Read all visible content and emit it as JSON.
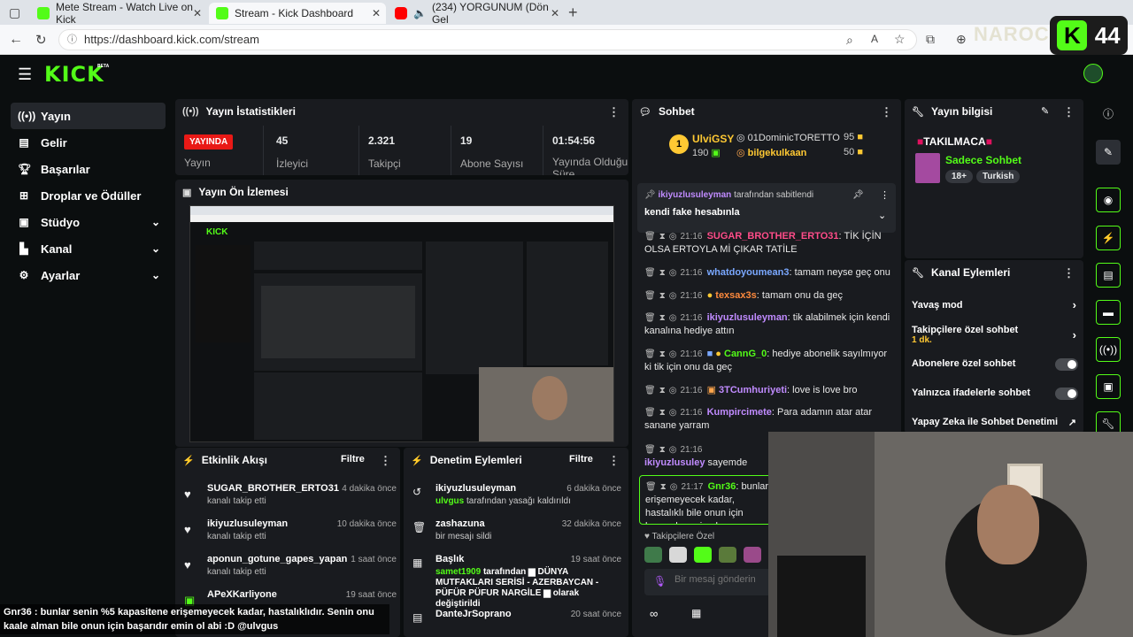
{
  "browser": {
    "tabs": [
      {
        "title": "Mete Stream - Watch Live on Kick"
      },
      {
        "title": "Stream - Kick Dashboard"
      },
      {
        "title": "(234) YORGUNUM (Dön Gel"
      }
    ],
    "url": "https://dashboard.kick.com/stream",
    "overlay_logo_text": "44",
    "overlay_watermark": "NAROC"
  },
  "brand": {
    "logo": "KICK",
    "logo_sup": "BETA",
    "accent": "#53fc18"
  },
  "sidebar": {
    "items": [
      {
        "label": "Yayın"
      },
      {
        "label": "Gelir"
      },
      {
        "label": "Başarılar"
      },
      {
        "label": "Droplar ve Ödüller"
      },
      {
        "label": "Stüdyo"
      },
      {
        "label": "Kanal"
      },
      {
        "label": "Ayarlar"
      }
    ]
  },
  "stats": {
    "title": "Yayın İstatistikleri",
    "live_badge": "YAYINDA",
    "live_label": "Yayın",
    "items": [
      {
        "value": "45",
        "label": "İzleyici"
      },
      {
        "value": "2.321",
        "label": "Takipçi"
      },
      {
        "value": "19",
        "label": "Abone Sayısı"
      },
      {
        "value": "01:54:56",
        "label": "Yayında Olduğu Süre"
      }
    ]
  },
  "preview": {
    "title": "Yayın Ön İzlemesi"
  },
  "activity": {
    "title": "Etkinlik Akışı",
    "filter": "Filtre",
    "items": [
      {
        "name": "SUGAR_BROTHER_ERTO31",
        "sub": "kanalı takip etti",
        "time": "4 dakika önce"
      },
      {
        "name": "ikiyuzlusuleyman",
        "sub": "kanalı takip etti",
        "time": "10 dakika önce"
      },
      {
        "name": "aponun_gotune_gapes_yapan",
        "sub": "kanalı takip etti",
        "time": "1 saat önce"
      },
      {
        "name": "APeXKarliyone",
        "sub": "",
        "time": "19 saat önce"
      }
    ]
  },
  "moderation": {
    "title": "Denetim Eylemleri",
    "filter": "Filtre",
    "items": [
      {
        "name": "ikiyuzlusuleyman",
        "actor": "ulvgus",
        "sub": "tarafından yasağı kaldırıldı",
        "time": "6 dakika önce"
      },
      {
        "name": "zashazuna",
        "actor": "",
        "sub": "bir mesajı sildi",
        "time": "32 dakika önce"
      },
      {
        "name": "Başlık",
        "actor": "samet1909",
        "sub": "tarafından ▆ DÜNYA MUTFAKLARI SERİSİ - AZERBAYCAN - PÜFÜR PÜFUR NARGİLE ▆ olarak değiştirildi",
        "time": "19 saat önce"
      },
      {
        "name": "DanteJrSoprano",
        "actor": "",
        "sub": "",
        "time": "20 saat önce"
      }
    ]
  },
  "chat": {
    "title": "Sohbet",
    "top": [
      {
        "name": "UlviGSY",
        "count": "190",
        "rank": "1"
      },
      {
        "name": "01DominicTORETTO",
        "count": "95"
      },
      {
        "name": "bilgekulkaan",
        "count": "50"
      }
    ],
    "pinned_by_user": "ikiyuzlusuleyman",
    "pinned_by_suffix": "tarafından sabitlendi",
    "pinned_text": "kendi fake hesabınla",
    "messages": [
      {
        "time": "21:16",
        "user": "SUGAR_BROTHER_ERTO31",
        "text": "TİK İÇİN OLSA ERTOYLA Mİ ÇIKAR TATİLE"
      },
      {
        "time": "21:16",
        "user": "whatdoyoumean3",
        "text": "tamam neyse geç onu"
      },
      {
        "time": "21:16",
        "user": "texsax3s",
        "text": "tamam onu da geç"
      },
      {
        "time": "21:16",
        "user": "ikiyuzlusuleyman",
        "text": "tik alabilmek için kendi kanalına hediye attın"
      },
      {
        "time": "21:16",
        "user": "CannG_0",
        "text": "hediye abonelik sayılmıyor ki tik için onu da geç"
      },
      {
        "time": "21:16",
        "user": "3TCumhuriyeti",
        "text": "love is love bro"
      },
      {
        "time": "21:16",
        "user": "Kumpircimete",
        "text": "Para adamın atar atar sanane yarram"
      },
      {
        "time": "21:16",
        "user": "ikiyuzlusuley",
        "text": "sayemde fazla izleniyosun bila"
      },
      {
        "time": "21:17",
        "user": "Gnr36",
        "text": "bunlar erişemeyecek kadar, hastalıklı bile onun için başarıdır emin ol"
      }
    ],
    "followers_only": "Takipçilere Özel",
    "input_placeholder": "Bir mesaj gönderin"
  },
  "stream_info": {
    "title": "Yayın bilgisi",
    "stream_title": "TAKILMACA",
    "category": "Sadece Sohbet",
    "tags": [
      "18+",
      "Turkish"
    ]
  },
  "channel_actions": {
    "title": "Kanal Eylemleri",
    "items": [
      {
        "label": "Yavaş mod"
      },
      {
        "label": "Takipçilere özel sohbet",
        "sub": "1 dk."
      },
      {
        "label": "Abonelere özel sohbet"
      },
      {
        "label": "Yalnızca ifadelerle sohbet"
      },
      {
        "label": "Yapay Zeka ile Sohbet Denetimi"
      }
    ]
  },
  "subtitle": "Gnr36 : bunlar senin %5 kapasitene erişemeyecek kadar, hastalıklıdır. Senin onu kaale alman bile onun için başarıdır emin ol abi :D @ulvgus",
  "subtitle_user": "Gnr36"
}
